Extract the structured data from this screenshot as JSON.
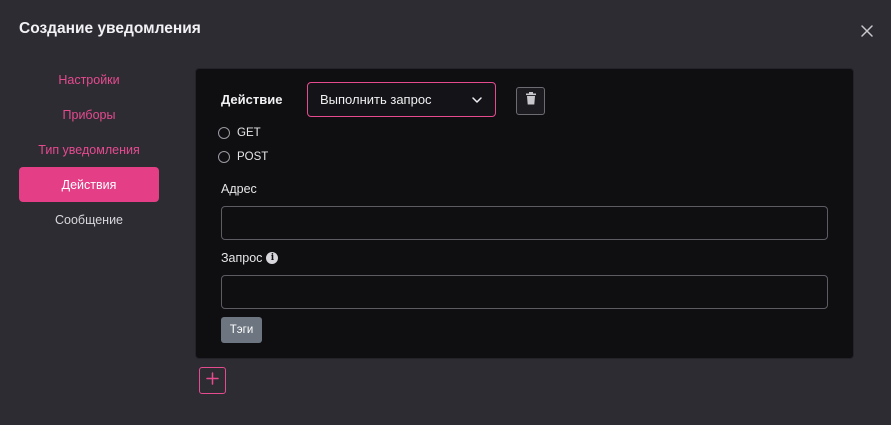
{
  "modal": {
    "title": "Создание уведомления"
  },
  "icons": {
    "close": "close-icon",
    "chevron": "chevron-down-icon",
    "delete": "trash-icon",
    "info": "info-icon",
    "add": "plus-icon"
  },
  "colors": {
    "accent": "#e33e86",
    "background": "#2d2c33",
    "card": "#0f0f12",
    "tags_button": "#6c7580"
  },
  "sidebar": {
    "items": [
      {
        "label": "Настройки"
      },
      {
        "label": "Приборы"
      },
      {
        "label": "Тип уведомления"
      },
      {
        "label": "Действия"
      },
      {
        "label": "Сообщение"
      }
    ],
    "active_index": 3
  },
  "action": {
    "label": "Действие",
    "select_value": "Выполнить запрос",
    "methods": [
      {
        "label": "GET",
        "selected": false
      },
      {
        "label": "POST",
        "selected": false
      }
    ],
    "address_label": "Адрес",
    "address_value": "",
    "request_label": "Запрос",
    "request_value": "",
    "info_glyph": "i",
    "tags_label": "Тэги"
  }
}
